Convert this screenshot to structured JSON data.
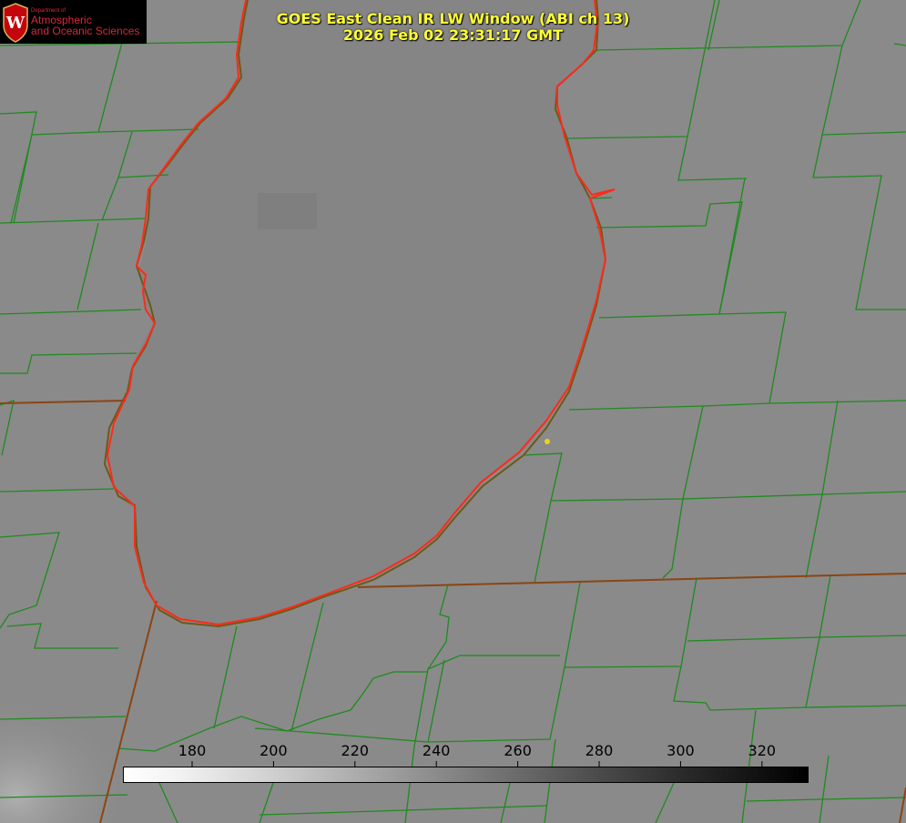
{
  "title": {
    "line1": "GOES East Clean IR LW Window (ABI ch 13)",
    "line2": "2026 Feb 02 23:31:17 GMT"
  },
  "logo": {
    "department": "Department of",
    "line1": "Atmospheric",
    "line2": "and Oceanic Sciences",
    "emblem_letter": "W"
  },
  "colorbar": {
    "ticks": [
      "180",
      "200",
      "220",
      "240",
      "260",
      "280",
      "300",
      "320"
    ],
    "min": 163,
    "max": 331,
    "colormap": [
      "#ffffff",
      "#000000"
    ]
  },
  "colors": {
    "background": "#8a8a8a",
    "lake": "#858585",
    "county_lines": "#1f8a1f",
    "state_lines": "#8b4513",
    "coastline": "#ff2a1a",
    "title": "#ffff33",
    "marker": "#e8d31a"
  }
}
